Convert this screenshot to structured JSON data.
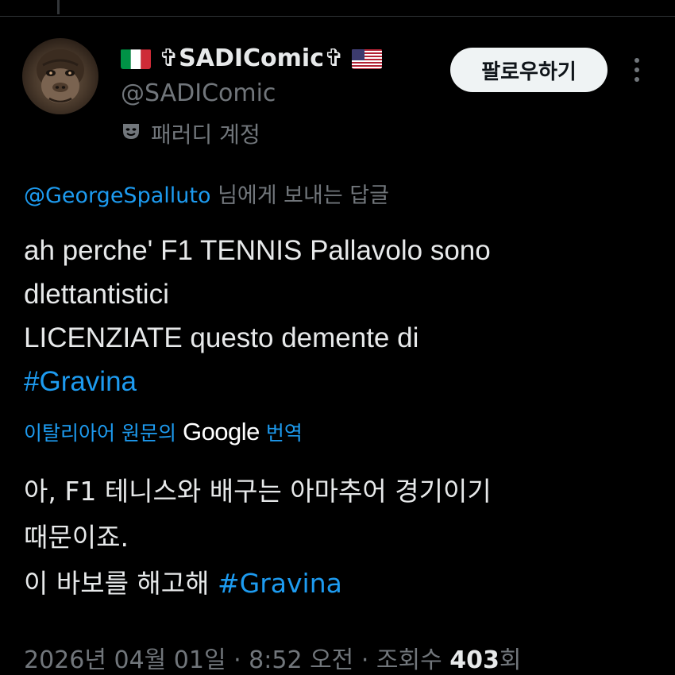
{
  "author": {
    "display_name": "✞SADIComic✞",
    "flag_left": "italy-flag-icon",
    "flag_right": "usa-flag-icon",
    "handle": "@SADIComic",
    "parody_label": "패러디 계정",
    "parody_icon": "theater-mask-icon"
  },
  "actions": {
    "follow_label": "팔로우하기",
    "more_icon": "more-vertical-icon"
  },
  "reply": {
    "mention": "@GeorgeSpalluto",
    "suffix": " 님에게 보내는 답글"
  },
  "tweet": {
    "line1": "ah perche' F1 TENNIS Pallavolo sono",
    "line2": "dlettantistici",
    "line3": "LICENZIATE questo demente di",
    "hashtag": "#Gravina"
  },
  "translation": {
    "prefix": "이탈리아어 원문의",
    "provider": "Google",
    "suffix": "번역",
    "line1": "아, F1 테니스와 배구는 아마추어 경기이기",
    "line2": "때문이죠.",
    "line3_text": "이 바보를 해고해 ",
    "line3_hashtag": "#Gravina"
  },
  "meta": {
    "date": "2026년 04월 01일 · 8:52 오전 · 조회수 ",
    "views": "403",
    "views_suffix": "회"
  },
  "colors": {
    "background": "#000000",
    "text": "#e7e9ea",
    "secondary": "#71767b",
    "accent": "#1d9bf0"
  }
}
